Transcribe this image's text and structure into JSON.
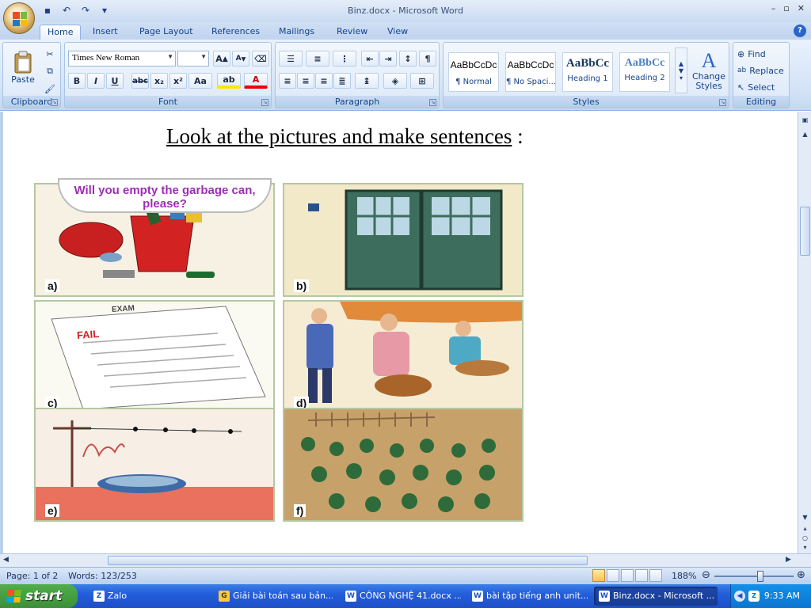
{
  "window": {
    "title": "Binz.docx - Microsoft Word",
    "minimize": "–",
    "maximize": "▫",
    "close": "✕"
  },
  "tabs": [
    {
      "label": "Home"
    },
    {
      "label": "Insert"
    },
    {
      "label": "Page Layout"
    },
    {
      "label": "References"
    },
    {
      "label": "Mailings"
    },
    {
      "label": "Review"
    },
    {
      "label": "View"
    }
  ],
  "ribbon": {
    "clipboard": {
      "label": "Clipboard",
      "paste": "Paste"
    },
    "font": {
      "label": "Font",
      "font_name": "Times New Roman",
      "font_size": "",
      "grow": "A",
      "shrink": "A",
      "bold": "B",
      "italic": "I",
      "underline": "U",
      "strike": "abc",
      "subscript": "x₂",
      "superscript": "x²",
      "change_case": "Aa",
      "highlight": "ab",
      "font_color": "A"
    },
    "paragraph": {
      "label": "Paragraph",
      "pilcrow": "¶"
    },
    "styles": {
      "label": "Styles",
      "items": [
        {
          "preview": "AaBbCcDc",
          "name": "¶ Normal"
        },
        {
          "preview": "AaBbCcDc",
          "name": "¶ No Spaci..."
        },
        {
          "preview": "AaBbCc",
          "name": "Heading 1"
        },
        {
          "preview": "AaBbCc",
          "name": "Heading 2"
        }
      ],
      "change_styles_1": "Change",
      "change_styles_2": "Styles"
    },
    "editing": {
      "label": "Editing",
      "find": "Find",
      "replace": "Replace",
      "select": "Select"
    }
  },
  "document": {
    "title": "Look at the pictures and make sentences",
    "title_suffix": " :",
    "pictures": [
      {
        "label": "a)",
        "caption": "Will you empty the garbage can, please?"
      },
      {
        "label": "b)"
      },
      {
        "label": "c)",
        "paper_title": "EXAM",
        "paper_mark": "FAIL"
      },
      {
        "label": "d)"
      },
      {
        "label": "e)"
      },
      {
        "label": "f)"
      }
    ]
  },
  "status": {
    "page": "Page: 1 of 2",
    "words": "Words: 123/253",
    "zoom": "188%"
  },
  "taskbar": {
    "start": "start",
    "items": [
      {
        "label": "Zalo",
        "icon": "Z"
      },
      {
        "label": "Giải bài toán sau bản...",
        "icon": "G"
      },
      {
        "label": "CÔNG NGHỆ 41.docx ...",
        "icon": "W"
      },
      {
        "label": "bài tập tiếng anh unit...",
        "icon": "W"
      },
      {
        "label": "Binz.docx - Microsoft ...",
        "icon": "W"
      }
    ],
    "clock": "9:33 AM"
  },
  "colors": {
    "ribbon_text": "#15428b",
    "speech_text": "#9b2fb3",
    "fail_red": "#d42020",
    "taskbar_blue": "#245edb",
    "start_green": "#3c8f39"
  }
}
